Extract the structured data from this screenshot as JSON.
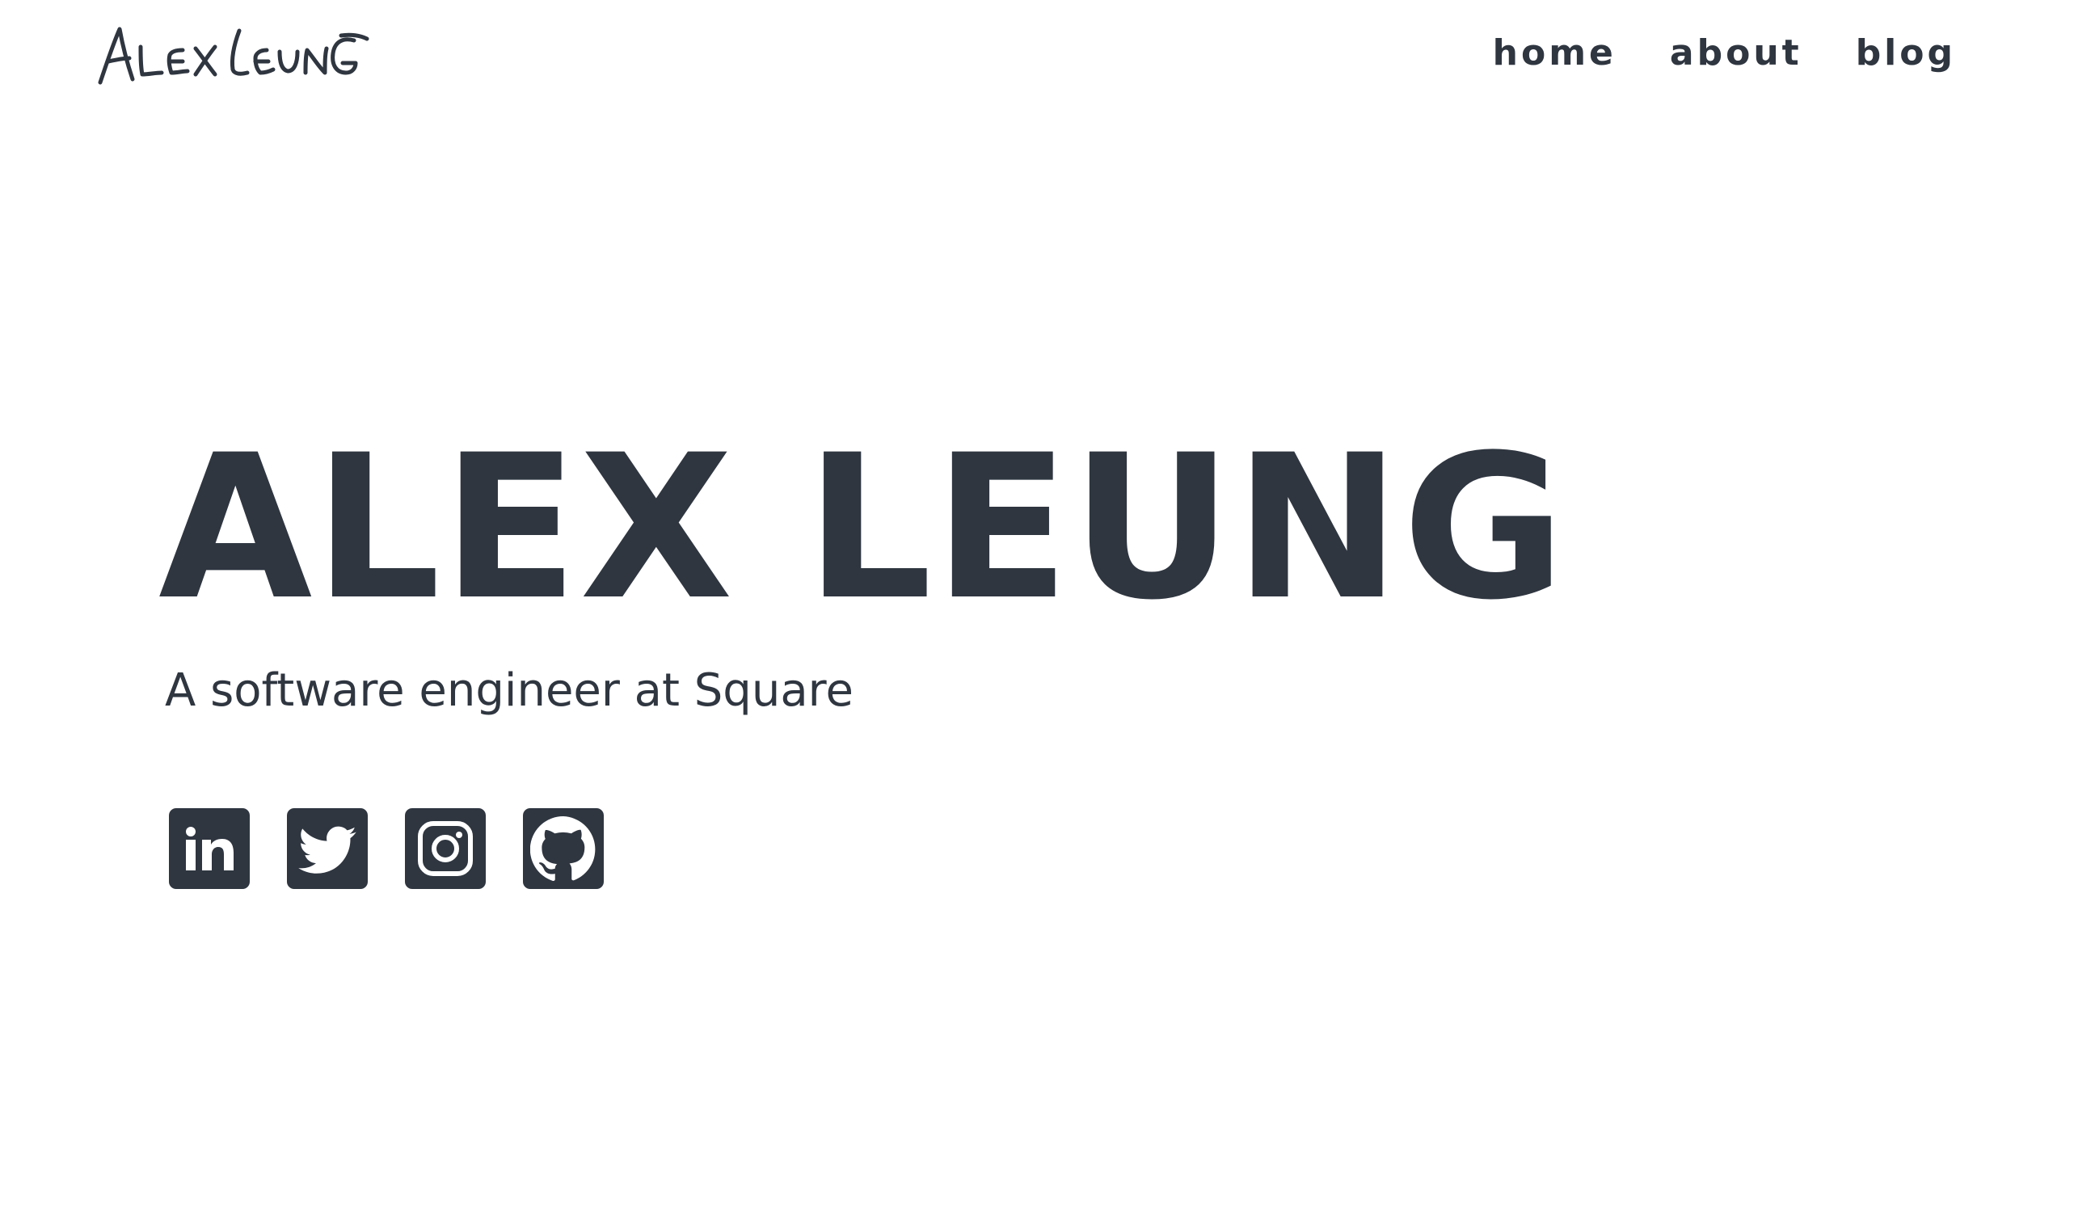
{
  "header": {
    "logo_text": "Alex Leung",
    "nav": [
      {
        "label": "home"
      },
      {
        "label": "about"
      },
      {
        "label": "blog"
      }
    ]
  },
  "hero": {
    "title": "ALEX LEUNG",
    "subtitle": "A software engineer at Square"
  },
  "socials": [
    {
      "icon": "linkedin-icon"
    },
    {
      "icon": "twitter-icon"
    },
    {
      "icon": "instagram-icon"
    },
    {
      "icon": "github-icon"
    }
  ],
  "colors": {
    "text": "#2f3640",
    "background": "#ffffff"
  }
}
